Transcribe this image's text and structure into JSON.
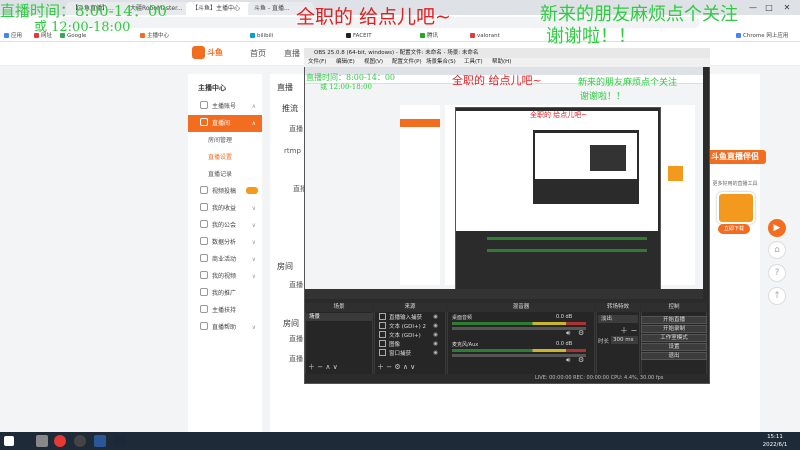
{
  "browser": {
    "tabs": [
      {
        "label": "【斗鱼直播】..."
      },
      {
        "label": "大疆RoboMaster..."
      },
      {
        "label": "【斗鱼】主播中心"
      },
      {
        "label": "斗鱼 - 直播..."
      }
    ],
    "bookmarks": [
      "应用",
      "网址",
      "Google",
      "主播中心",
      "bilibili",
      "FACEIT",
      "腾讯",
      "valorant",
      "Chrome 网上应用"
    ],
    "window_controls": [
      "—",
      "□",
      "✕"
    ]
  },
  "site": {
    "logo_text": "斗鱼",
    "nav": [
      "首页",
      "直播"
    ],
    "sidebar": [
      {
        "label": "主播中心",
        "type": "header"
      },
      {
        "label": "主播账号",
        "type": "item"
      },
      {
        "label": "直播间",
        "type": "active"
      },
      {
        "label": "房间管理",
        "type": "sub"
      },
      {
        "label": "直播设置",
        "type": "subact"
      },
      {
        "label": "直播记录",
        "type": "sub"
      },
      {
        "label": "视频投稿",
        "type": "item"
      },
      {
        "label": "我的收益",
        "type": "item"
      },
      {
        "label": "我的公会",
        "type": "item"
      },
      {
        "label": "数据分析",
        "type": "item"
      },
      {
        "label": "商业活动",
        "type": "item"
      },
      {
        "label": "我的视频",
        "type": "item"
      },
      {
        "label": "我的推广",
        "type": "item"
      },
      {
        "label": "主播扶持",
        "type": "item"
      },
      {
        "label": "直播帮助",
        "type": "item"
      }
    ],
    "content_labels": [
      "直播",
      "推流",
      "直播",
      "rtmp",
      "直播",
      "房间",
      "直播",
      "直播",
      "直播",
      "房间"
    ],
    "promo": {
      "title": "斗鱼直播伴侣",
      "subtitle": "更多好用的直播工具",
      "button": "立即下载"
    }
  },
  "obs": {
    "title": "OBS 25.0.8 (64-bit, windows) - 配置文件: 未命名 - 场景: 未命名",
    "menu": [
      "文件(F)",
      "编辑(E)",
      "视图(V)",
      "配置文件(P)",
      "场景集合(S)",
      "工具(T)",
      "帮助(H)"
    ],
    "docks": {
      "scenes": "场景",
      "sources": "来源",
      "mixer": "混音器",
      "transitions": "转场特效",
      "controls": "控制"
    },
    "scene_item": "场景",
    "sources": [
      "直播输入捕获",
      "文本 (GDI+) 2",
      "文本 (GDI+)",
      "图像",
      "窗口捕获"
    ],
    "mixer": [
      {
        "label": "桌面音频",
        "db": "0.0 dB"
      },
      {
        "label": "麦克风/Aux",
        "db": "0.0 dB"
      }
    ],
    "transition": "淡出",
    "duration_label": "时长",
    "duration": "300 ms",
    "controls": [
      "开始直播",
      "开始录制",
      "工作室模式",
      "设置",
      "退出"
    ],
    "status": "LIVE: 00:00:00    REC: 00:00:00    CPU: 4.4%, 30.00 fps"
  },
  "overlays": {
    "schedule_line1": "直播时间：8:00-14：00",
    "schedule_line2": "或 12:00-18:00",
    "headline": "全职的 给点儿吧~",
    "welcome_line1": "新来的朋友麻烦点个关注",
    "welcome_line2": "谢谢啦！！"
  },
  "taskbar": {
    "time": "15:11",
    "date": "2022/6/1"
  }
}
